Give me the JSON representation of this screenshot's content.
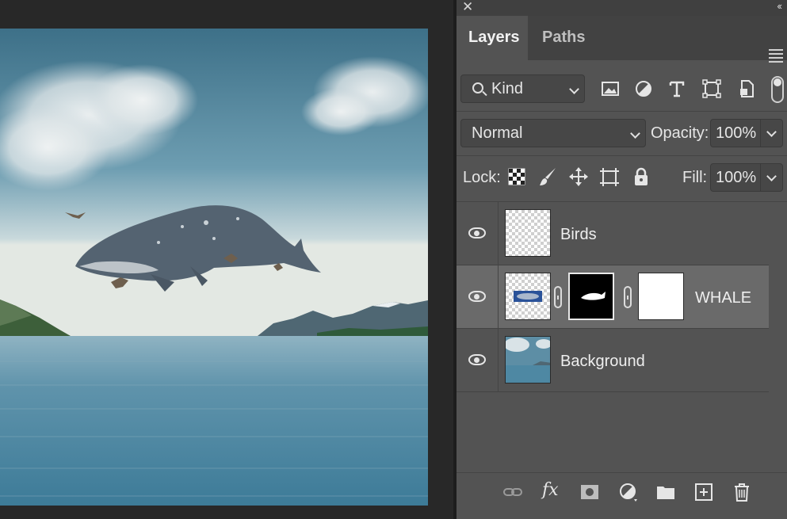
{
  "panel": {
    "close_glyph": "✕",
    "collapse_glyph": "‹‹",
    "tabs": [
      {
        "label": "Layers",
        "active": true
      },
      {
        "label": "Paths",
        "active": false
      }
    ],
    "menu_icon": "hamburger-menu-icon"
  },
  "filter": {
    "kind_label": "Kind",
    "icons": [
      "image-filter-icon",
      "adjustment-filter-icon",
      "type-filter-icon",
      "shape-filter-icon",
      "smart-object-filter-icon"
    ]
  },
  "blend": {
    "mode": "Normal",
    "opacity_label": "Opacity:",
    "opacity_value": "100%"
  },
  "lock": {
    "label": "Lock:",
    "icons": [
      "lock-transparent-pixels-icon",
      "lock-image-pixels-icon",
      "lock-position-icon",
      "lock-artboard-icon",
      "lock-all-icon"
    ],
    "fill_label": "Fill:",
    "fill_value": "100%"
  },
  "layers": [
    {
      "name": "Birds",
      "visible": true,
      "selected": false
    },
    {
      "name": "WHALE",
      "visible": true,
      "selected": true
    },
    {
      "name": "Background",
      "visible": true,
      "selected": false
    }
  ],
  "bottom_bar": {
    "icons": [
      "link-layers-icon",
      "fx-layer-style-icon",
      "add-mask-icon",
      "new-adjustment-layer-icon",
      "new-group-icon",
      "new-layer-icon",
      "delete-layer-icon"
    ],
    "fx_text": "fx"
  },
  "colors": {
    "panel_bg": "#535353",
    "selected_row": "#6a6a6a",
    "app_bg": "#282828"
  }
}
